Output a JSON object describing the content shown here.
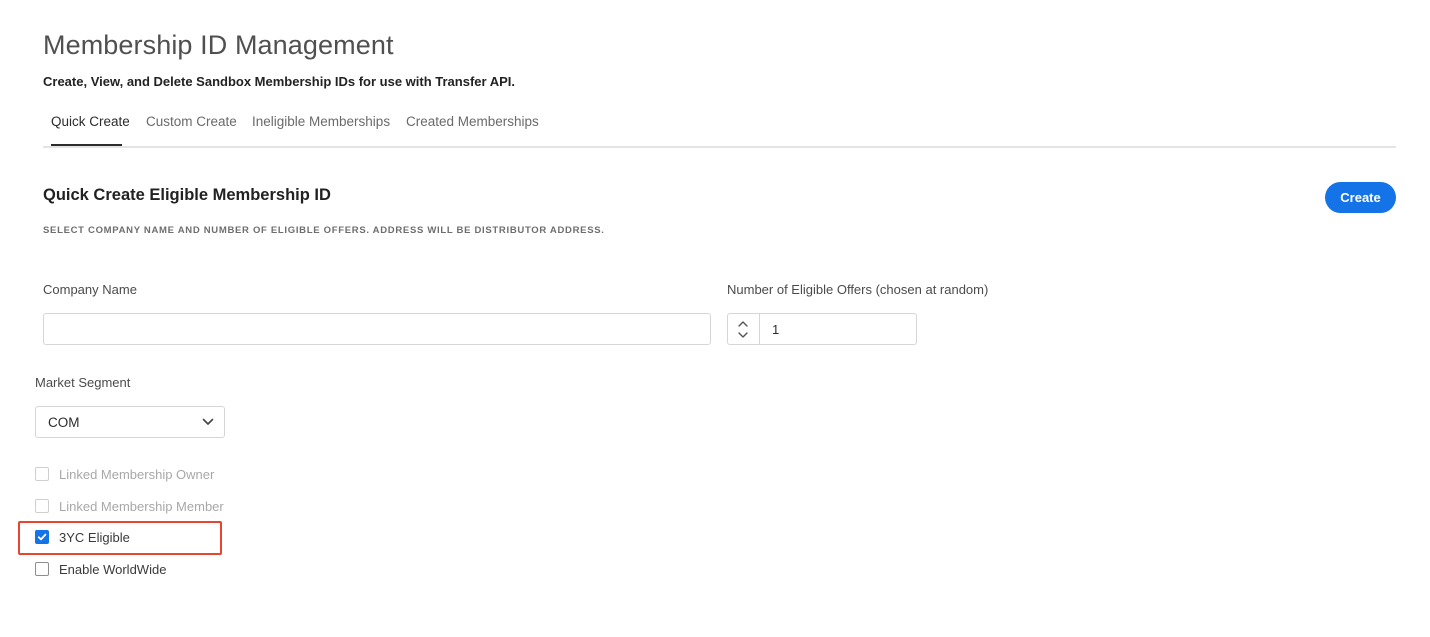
{
  "header": {
    "title": "Membership ID Management",
    "subtitle": "Create, View, and Delete Sandbox Membership IDs for use with Transfer API."
  },
  "tabs": [
    {
      "label": "Quick Create",
      "active": true
    },
    {
      "label": "Custom Create",
      "active": false
    },
    {
      "label": "Ineligible Memberships",
      "active": false
    },
    {
      "label": "Created Memberships",
      "active": false
    }
  ],
  "section": {
    "title": "Quick Create Eligible Membership ID",
    "description": "SELECT COMPANY NAME AND NUMBER OF ELIGIBLE OFFERS. ADDRESS WILL BE DISTRIBUTOR ADDRESS.",
    "create_label": "Create"
  },
  "form": {
    "company_name": {
      "label": "Company Name",
      "value": "",
      "placeholder": ""
    },
    "eligible_offers": {
      "label": "Number of Eligible Offers (chosen at random)",
      "value": "1"
    },
    "market_segment": {
      "label": "Market Segment",
      "selected": "COM"
    },
    "checkboxes": [
      {
        "label": "Linked Membership Owner",
        "checked": false,
        "disabled": true
      },
      {
        "label": "Linked Membership Member",
        "checked": false,
        "disabled": true
      },
      {
        "label": "3YC Eligible",
        "checked": true,
        "disabled": false,
        "highlighted": true
      },
      {
        "label": "Enable WorldWide",
        "checked": false,
        "disabled": false
      }
    ]
  },
  "colors": {
    "accent": "#1473e6",
    "highlight": "#e84530"
  }
}
